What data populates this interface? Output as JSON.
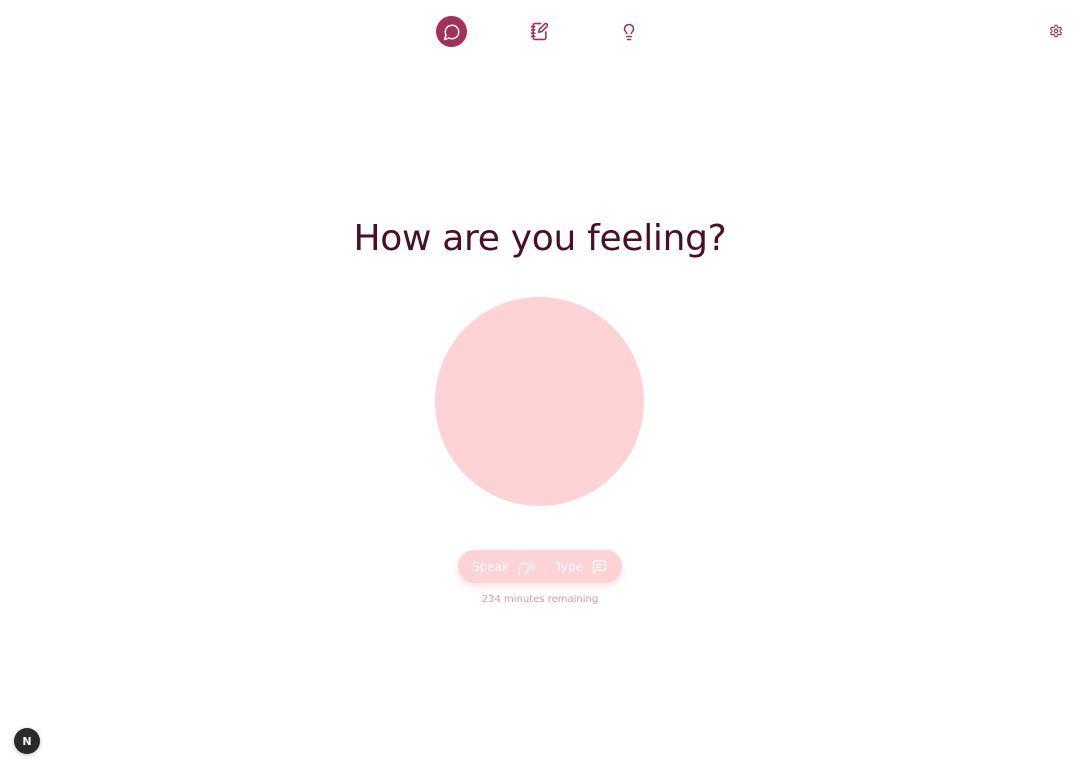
{
  "nav": {
    "items": [
      {
        "id": "chat",
        "icon": "chat-bubble-icon",
        "active": true
      },
      {
        "id": "journal",
        "icon": "journal-edit-icon",
        "active": false
      },
      {
        "id": "insights",
        "icon": "lightbulb-icon",
        "active": false
      }
    ],
    "settings_icon": "gear-icon"
  },
  "main": {
    "title": "How are you feeling?",
    "modes": {
      "speak_label": "Speak",
      "speak_icon": "speaking-head-icon",
      "type_label": "Type",
      "type_icon": "message-text-icon"
    },
    "remaining_text": "234 minutes remaining"
  },
  "dev_badge": {
    "label": "N"
  },
  "colors": {
    "accent": "#a3305a",
    "title": "#4a0e26",
    "orb": "#fdd3d6",
    "pill": "#fdd3d6",
    "muted_text": "#d59ba8"
  }
}
